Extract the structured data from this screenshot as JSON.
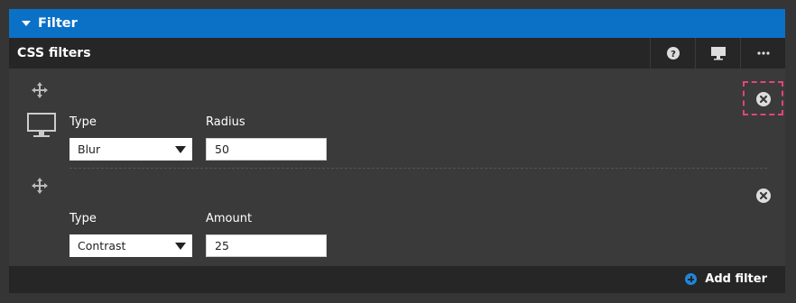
{
  "panel": {
    "title": "Filter"
  },
  "section": {
    "title": "CSS filters"
  },
  "toolbar": {
    "help_icon": "help-icon",
    "device_icon": "monitor-icon",
    "more_icon": "more-icon"
  },
  "filters": [
    {
      "type_label": "Type",
      "type_value": "Blur",
      "param_label": "Radius",
      "param_value": "50"
    },
    {
      "type_label": "Type",
      "type_value": "Contrast",
      "param_label": "Amount",
      "param_value": "25"
    }
  ],
  "footer": {
    "add_label": "Add filter"
  },
  "colors": {
    "header": "#0a71c7",
    "highlight": "#e0457b",
    "accent": "#1e86da"
  }
}
